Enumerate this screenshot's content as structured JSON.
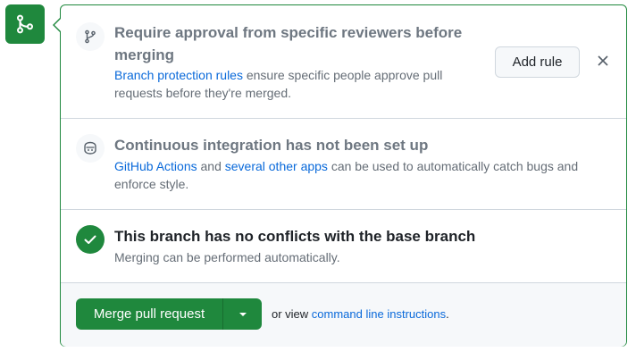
{
  "colors": {
    "success": "#1f883d",
    "link": "#0969da",
    "muted": "#656d76"
  },
  "badge": {
    "icon": "git-merge-icon"
  },
  "review": {
    "icon": "git-branch-icon",
    "title": "Require approval from specific reviewers before merging",
    "desc_link": "Branch protection rules",
    "desc_text": " ensure specific people approve pull requests before they're merged.",
    "add_rule_label": "Add rule",
    "close_icon": "close-icon"
  },
  "ci": {
    "icon": "copilot-icon",
    "title": "Continuous integration has not been set up",
    "desc_link1": "GitHub Actions",
    "desc_mid": " and ",
    "desc_link2": "several other apps",
    "desc_text": " can be used to automatically catch bugs and enforce style."
  },
  "conflict": {
    "icon": "check-icon",
    "title": "This branch has no conflicts with the base branch",
    "desc": "Merging can be performed automatically."
  },
  "footer": {
    "merge_label": "Merge pull request",
    "dropdown_icon": "triangle-down-icon",
    "or_view": "or view ",
    "cli_link": "command line instructions",
    "period": "."
  }
}
